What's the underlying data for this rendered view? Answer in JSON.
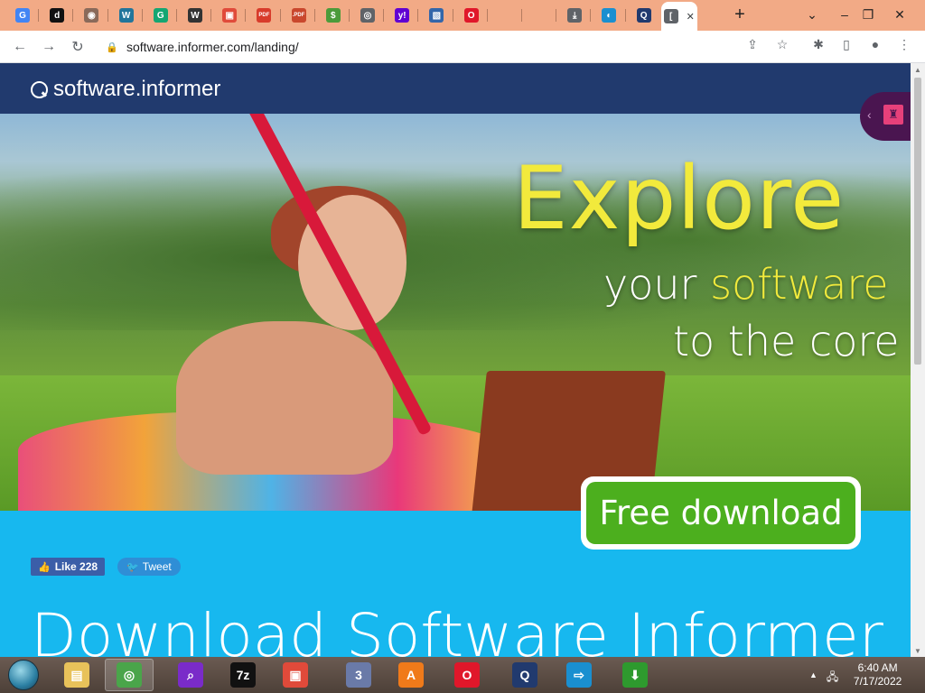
{
  "browser": {
    "tabs": [
      {
        "icon": "google-icon",
        "glyph": "G",
        "color": "#4285f4"
      },
      {
        "icon": "pinned-app-icon",
        "glyph": "d",
        "color": "#111111"
      },
      {
        "icon": "globe-icon",
        "glyph": "◉",
        "color": "#8a6a5a"
      },
      {
        "icon": "wordpress-icon",
        "glyph": "W",
        "color": "#21759b"
      },
      {
        "icon": "grammarly-icon",
        "glyph": "G",
        "color": "#15a672"
      },
      {
        "icon": "wikipedia-icon",
        "glyph": "W",
        "color": "#333333"
      },
      {
        "icon": "gift-icon",
        "glyph": "▣",
        "color": "#e04a3a"
      },
      {
        "icon": "pdf-icon",
        "glyph": "PDF",
        "color": "#d83b2b"
      },
      {
        "icon": "pdf-converter-icon",
        "glyph": ".PDF",
        "color": "#c9472d"
      },
      {
        "icon": "money-icon",
        "glyph": "$",
        "color": "#4b9b3a"
      },
      {
        "icon": "chrome-icon",
        "glyph": "◎",
        "color": "#5f6368"
      },
      {
        "icon": "yahoo-icon",
        "glyph": "y!",
        "color": "#6001d2"
      },
      {
        "icon": "image-icon",
        "glyph": "▧",
        "color": "#3366aa"
      },
      {
        "icon": "opera-icon",
        "glyph": "O",
        "color": "#e0172a"
      },
      {
        "icon": "blank-tab-icon",
        "glyph": "",
        "color": "#f2aa86"
      },
      {
        "icon": "blank-tab-icon",
        "glyph": "",
        "color": "#f2aa86"
      },
      {
        "icon": "download-icon",
        "glyph": "⤓",
        "color": "#5f6368"
      },
      {
        "icon": "cloud-icon",
        "glyph": "◐",
        "color": "#1a8fd0"
      },
      {
        "icon": "software-informer-icon",
        "glyph": "Q",
        "color": "#213a6e"
      },
      {
        "icon": "active-tab-icon",
        "glyph": "[",
        "color": "#5f6368"
      }
    ],
    "close_tab": "✕",
    "new_tab": "+",
    "window_controls": {
      "list": "⌄",
      "minimize": "–",
      "restore": "❐",
      "close": "✕"
    },
    "nav": {
      "back": "←",
      "forward": "→",
      "reload": "↻"
    },
    "url": "software.informer.com/landing/",
    "omnibox_icons": {
      "share": "⇪",
      "bookmark": "☆"
    },
    "toolbar_icons": {
      "extensions": "✱",
      "sidepanel": "▯",
      "profile": "●",
      "menu": "⋮"
    }
  },
  "site": {
    "logo_text": "software.informer",
    "hero": {
      "headline": "Explore",
      "line2_plain": "your ",
      "line2_highlight": "software",
      "line3": "to the core"
    },
    "side_badge": {
      "chevron": "‹",
      "icon": "castle-icon",
      "glyph": "♜"
    },
    "cta_label": "Free download",
    "social": {
      "like_label": "Like 228",
      "like_icon": "👍",
      "tweet_label": "Tweet",
      "tweet_icon": "🐦"
    },
    "page_title": "Download Software Informer"
  },
  "taskbar": {
    "apps": [
      {
        "name": "explorer-icon",
        "glyph": "▤",
        "color": "#e8c25a"
      },
      {
        "name": "chrome-icon",
        "glyph": "◎",
        "color": "#4aa54a",
        "active": true
      },
      {
        "name": "search-app-icon",
        "glyph": "⌕",
        "color": "#7a2bc9"
      },
      {
        "name": "7zip-icon",
        "glyph": "7z",
        "color": "#111111"
      },
      {
        "name": "photo-app-icon",
        "glyph": "▣",
        "color": "#e04a3a"
      },
      {
        "name": "calendar-app-icon",
        "glyph": "3",
        "color": "#6a7aa8"
      },
      {
        "name": "avast-icon",
        "glyph": "A",
        "color": "#f07a1a"
      },
      {
        "name": "opera-icon",
        "glyph": "O",
        "color": "#e0172a"
      },
      {
        "name": "software-informer-icon",
        "glyph": "Q",
        "color": "#213a6e"
      },
      {
        "name": "remote-app-icon",
        "glyph": "⇨",
        "color": "#1a8fd0"
      },
      {
        "name": "downloader-icon",
        "glyph": "⬇",
        "color": "#2e9a2e"
      }
    ],
    "tray": {
      "show_hidden": "▲",
      "network": "🖧"
    },
    "time": "6:40 AM",
    "date": "7/17/2022"
  }
}
